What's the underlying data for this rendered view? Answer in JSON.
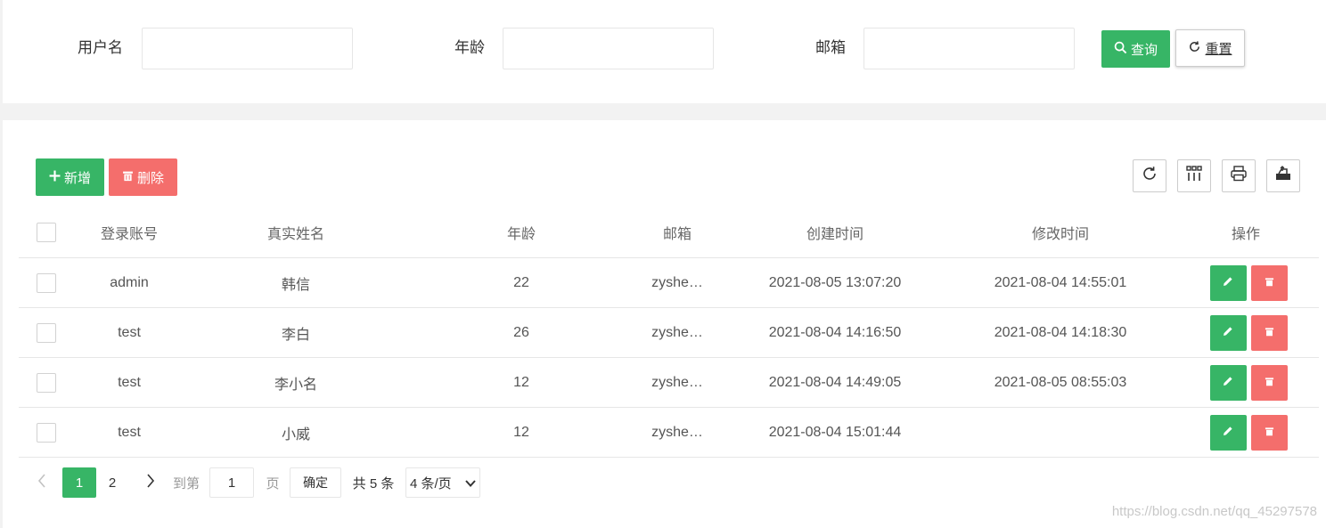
{
  "search": {
    "username_label": "用户名",
    "username_value": "",
    "age_label": "年龄",
    "age_value": "",
    "email_label": "邮箱",
    "email_value": "",
    "query_label": "查询",
    "reset_label": "重置"
  },
  "toolbar": {
    "add_label": "新增",
    "delete_label": "删除",
    "tools": [
      "refresh-icon",
      "columns-icon",
      "print-icon",
      "export-icon"
    ]
  },
  "table": {
    "headers": [
      "登录账号",
      "真实姓名",
      "年龄",
      "邮箱",
      "创建时间",
      "修改时间",
      "操作"
    ],
    "rows": [
      {
        "account": "admin",
        "name": "韩信",
        "age": "22",
        "email": "zyshe…",
        "created": "2021-08-05 13:07:20",
        "modified": "2021-08-04 14:55:01"
      },
      {
        "account": "test",
        "name": "李白",
        "age": "26",
        "email": "zyshe…",
        "created": "2021-08-04 14:16:50",
        "modified": "2021-08-04 14:18:30"
      },
      {
        "account": "test",
        "name": "李小名",
        "age": "12",
        "email": "zyshe…",
        "created": "2021-08-04 14:49:05",
        "modified": "2021-08-05 08:55:03"
      },
      {
        "account": "test",
        "name": "小威",
        "age": "12",
        "email": "zyshe…",
        "created": "2021-08-04 15:01:44",
        "modified": ""
      }
    ]
  },
  "pagination": {
    "page1": "1",
    "page2": "2",
    "goto_label": "到第",
    "goto_value": "1",
    "page_suffix": "页",
    "confirm_label": "确定",
    "total_text": "共 5 条",
    "page_size": "4 条/页"
  },
  "watermark": "https://blog.csdn.net/qq_45297578",
  "colors": {
    "primary": "#37b566",
    "danger": "#f46e6c"
  }
}
